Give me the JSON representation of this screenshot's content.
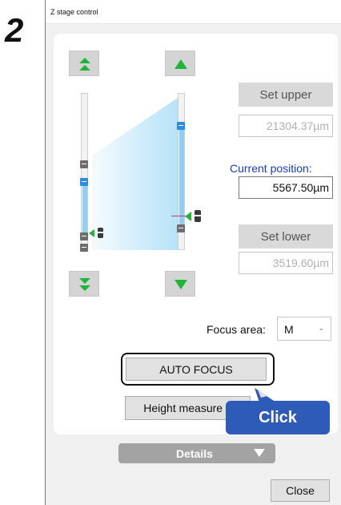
{
  "step_number": "2",
  "window": {
    "title": "Z stage control"
  },
  "stage": {
    "set_upper_label": "Set upper",
    "upper_value": "21304.37µm",
    "current_position_label": "Current position:",
    "current_position_value": "5567.50µm",
    "set_lower_label": "Set lower",
    "lower_value": "3519.60µm"
  },
  "focus_area": {
    "label": "Focus area:",
    "value": "M"
  },
  "buttons": {
    "auto_focus": "AUTO FOCUS",
    "height_measure": "Height measure 2",
    "details": "Details",
    "close": "Close"
  },
  "callout": {
    "text": "Click"
  },
  "icons": {
    "step_up_fast": "double-up-arrow-icon",
    "step_up": "up-arrow-icon",
    "step_down_fast": "double-down-arrow-icon",
    "step_down": "down-arrow-icon",
    "details_toggle": "triangle-down-icon",
    "objective": "objective-lens-icon"
  },
  "colors": {
    "arrow_green": "#1fb53a",
    "accent_blue": "#2b8de3",
    "label_blue": "#1a3bd1",
    "callout_blue": "#2f5bb8",
    "rail_fill": "#8ecff7"
  }
}
